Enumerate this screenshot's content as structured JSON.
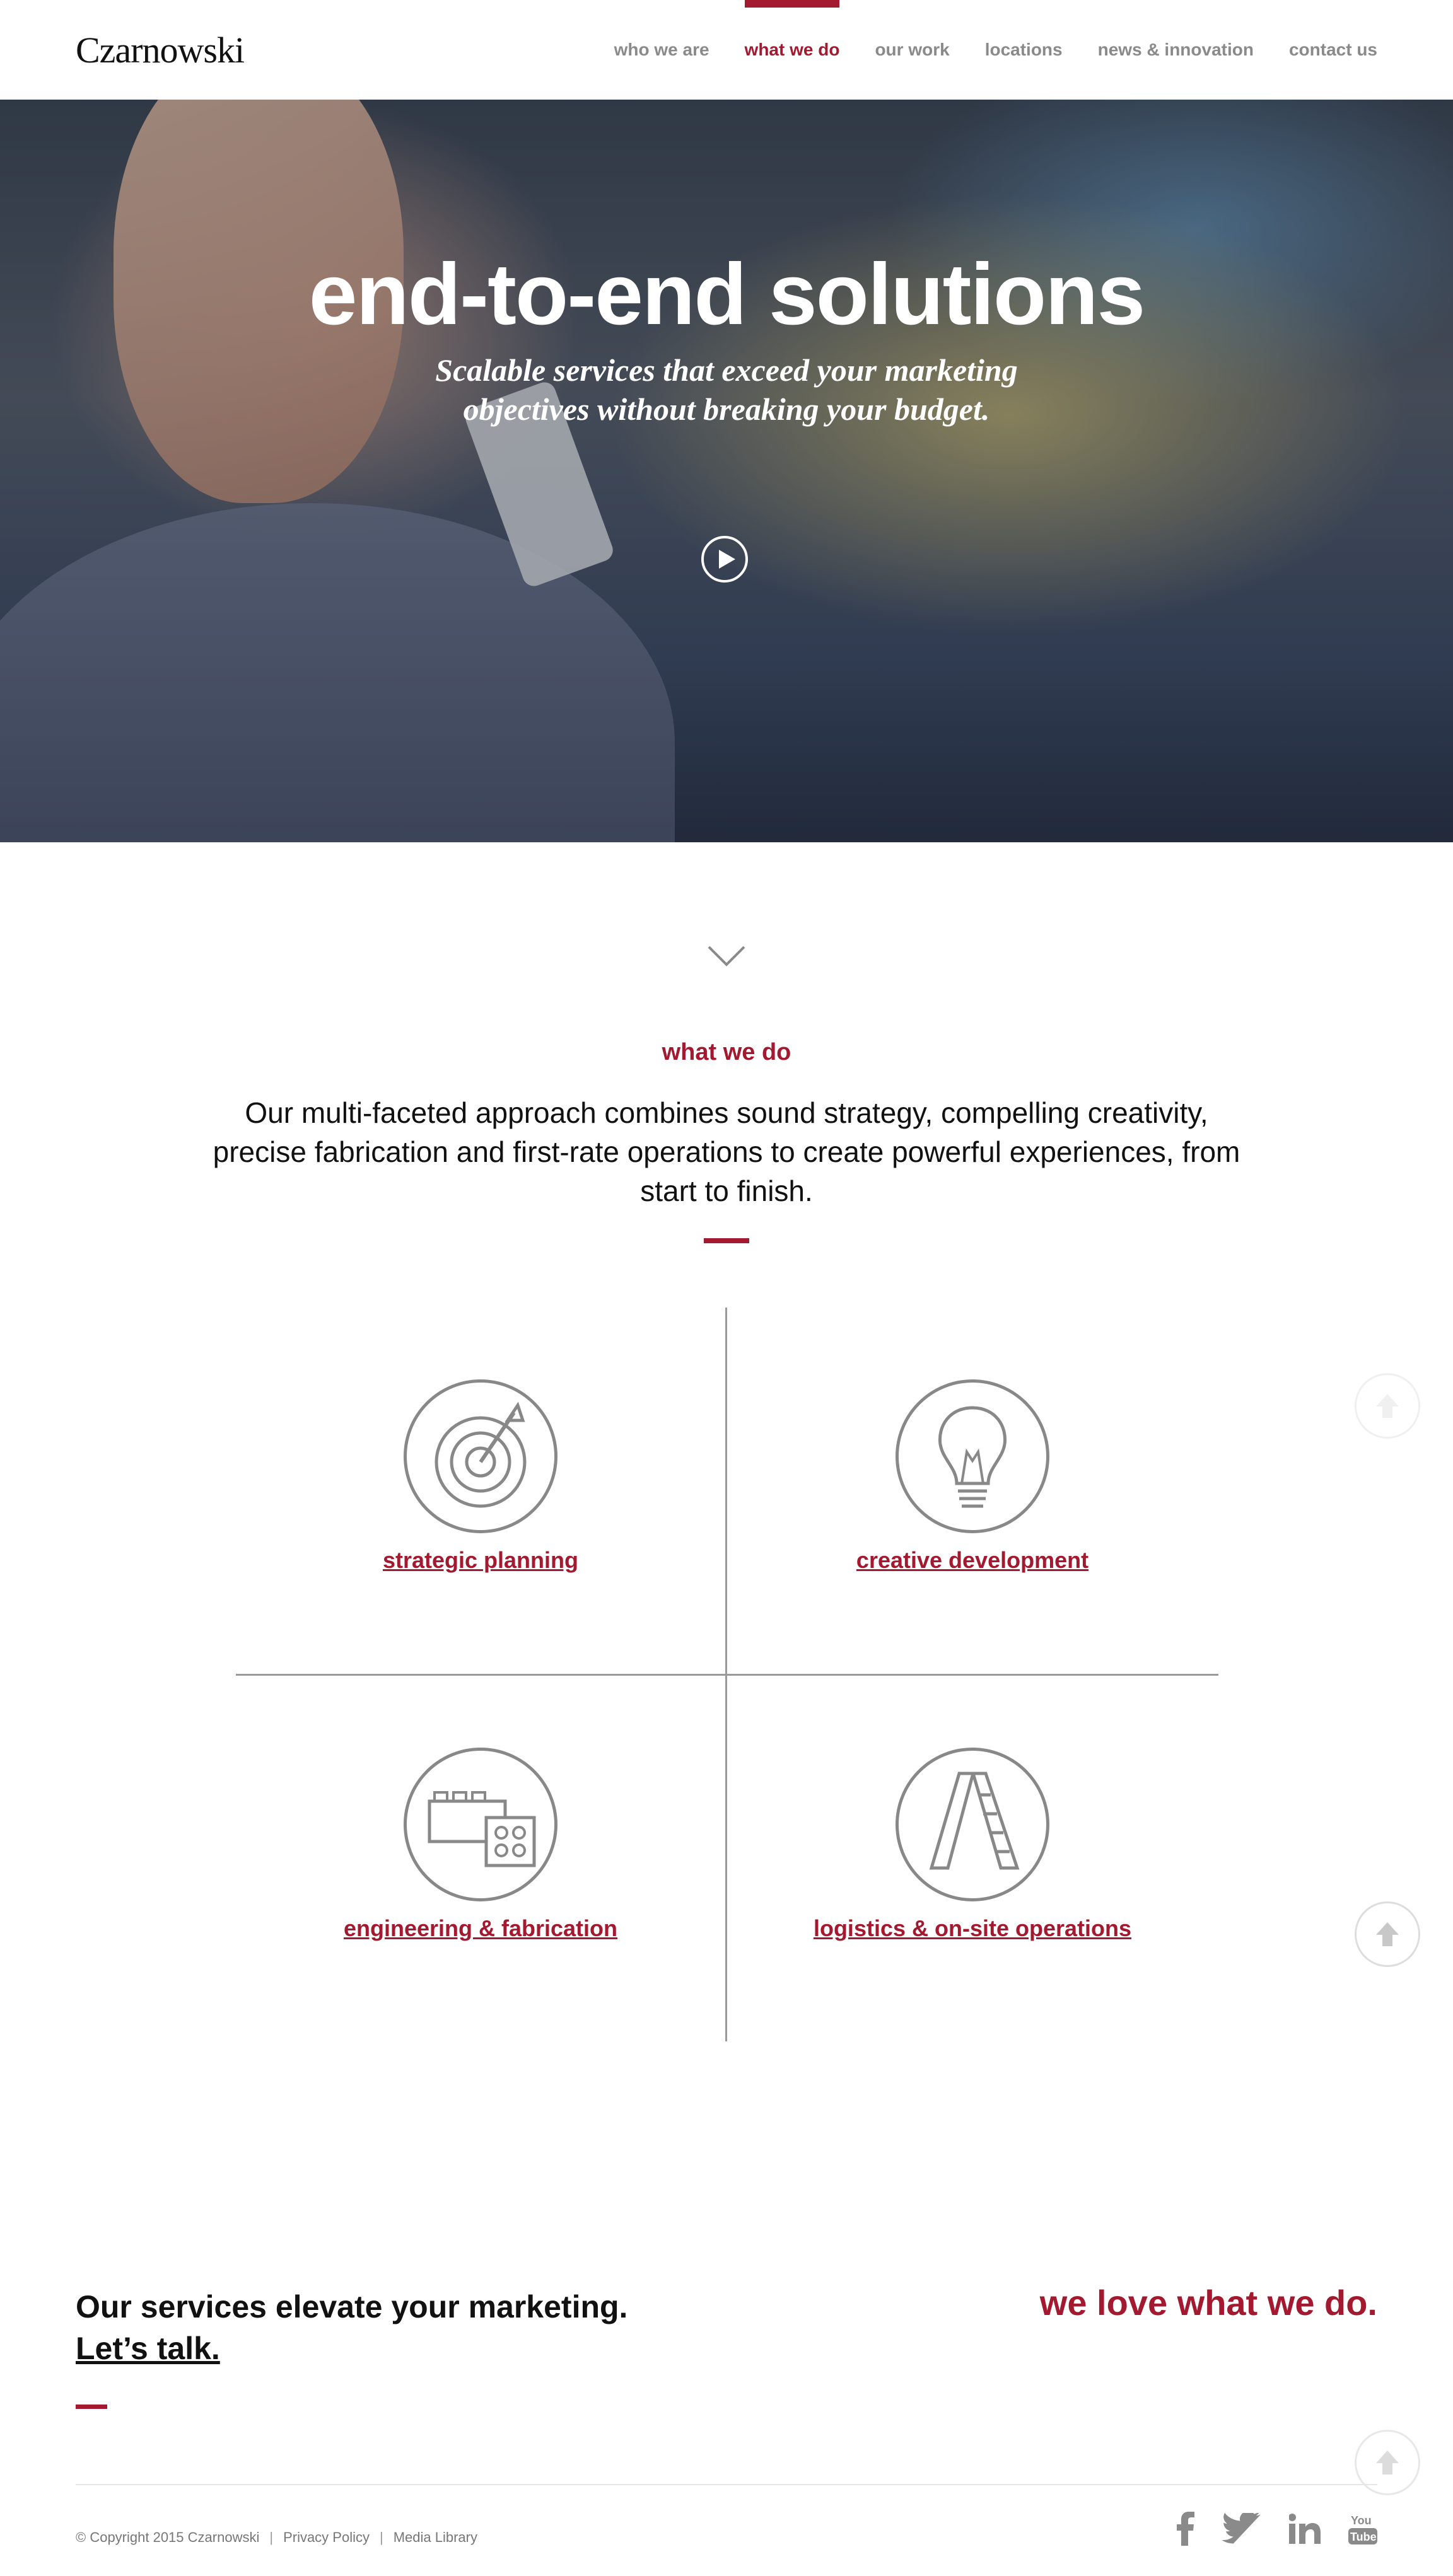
{
  "header": {
    "logo": "Czarnowski",
    "nav": [
      "who we are",
      "what we do",
      "our work",
      "locations",
      "news & innovation",
      "contact us"
    ],
    "active_index": 1
  },
  "hero": {
    "title": "end-to-end solutions",
    "subtitle": "Scalable services that exceed your marketing objectives without breaking your budget."
  },
  "intro": {
    "label": "what we do",
    "text": "Our multi-faceted approach combines sound strategy, compelling creativity, precise fabrication and first-rate operations to create powerful experiences, from start to finish."
  },
  "services": [
    {
      "label": "strategic planning",
      "icon": "target-dart-icon"
    },
    {
      "label": "creative development",
      "icon": "lightbulb-icon"
    },
    {
      "label": "engineering & fabrication",
      "icon": "building-blocks-icon"
    },
    {
      "label": "logistics & on-site operations",
      "icon": "ladder-icon"
    }
  ],
  "cta": {
    "line1": "Our services elevate your marketing.",
    "link": "Let’s talk.",
    "tagline": "we love what we do."
  },
  "footer": {
    "copyright": "© Copyright 2015 Czarnowski",
    "privacy": "Privacy Policy",
    "media": "Media Library",
    "separator": "|",
    "social": [
      "facebook-icon",
      "twitter-icon",
      "linkedin-icon",
      "youtube-icon"
    ]
  },
  "colors": {
    "accent": "#a3192f",
    "nav_gray": "#8a8a8a",
    "icon_gray": "#888888"
  }
}
